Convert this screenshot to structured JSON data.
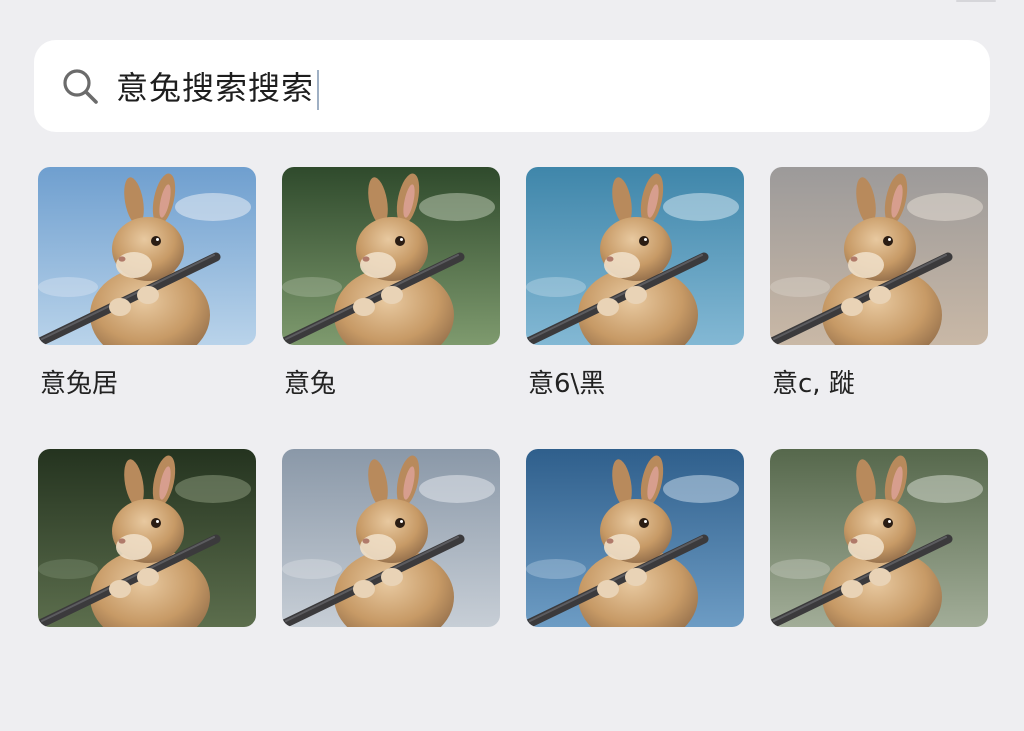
{
  "search": {
    "query": "意兔搜索搜索",
    "icon": "search-icon"
  },
  "colors": {
    "page_background": "#eeeef1",
    "search_background": "#ffffff",
    "caret": "#9fb0c4"
  },
  "results": [
    {
      "caption": "意兔居",
      "background": "sky-blue",
      "bg1": "#6f9fcf",
      "bg2": "#b9d3ea",
      "accent": "#e9eef5"
    },
    {
      "caption": "意兔",
      "background": "forest-green",
      "bg1": "#2f4a2c",
      "bg2": "#7e9a6e",
      "accent": "#b9c7b0"
    },
    {
      "caption": "意6\\黑",
      "background": "teal-sky",
      "bg1": "#3f86aa",
      "bg2": "#83b8d4",
      "accent": "#d2e6f0"
    },
    {
      "caption": "意c, 蹝",
      "background": "grey-field",
      "bg1": "#9c9a9a",
      "bg2": "#c9b8a6",
      "accent": "#e3dcd4"
    },
    {
      "caption": "",
      "background": "dark-forest",
      "bg1": "#24331f",
      "bg2": "#5c6e4d",
      "accent": "#88977a"
    },
    {
      "caption": "",
      "background": "cloudy-grey",
      "bg1": "#8a98a8",
      "bg2": "#c7ced6",
      "accent": "#e4e8ec"
    },
    {
      "caption": "",
      "background": "blue-sky",
      "bg1": "#2f5f8c",
      "bg2": "#6d9cc4",
      "accent": "#c7d9ea"
    },
    {
      "caption": "",
      "background": "green-grey",
      "bg1": "#56684c",
      "bg2": "#a2ad98",
      "accent": "#d3d8cd"
    }
  ]
}
